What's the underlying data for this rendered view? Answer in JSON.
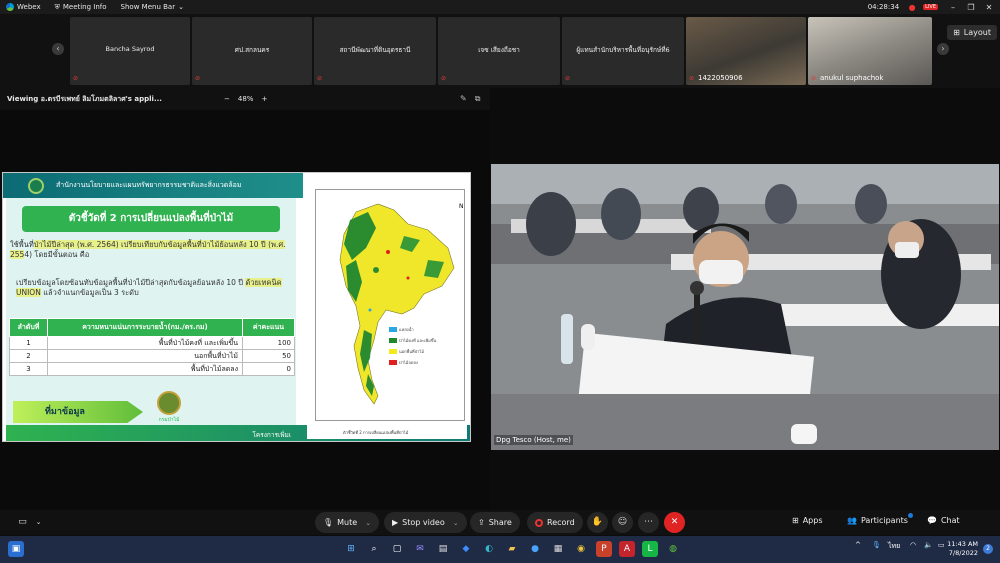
{
  "topbar": {
    "app_name": "Webex",
    "meeting_info": "Meeting Info",
    "show_menu_bar": "Show Menu Bar",
    "timer": "04:28:34",
    "live_badge": "LIVE"
  },
  "participants": [
    {
      "name": "Bancha Sayrod"
    },
    {
      "name": "ศป.สกลนคร"
    },
    {
      "name": "สถานีพัฒนาที่ดินอุดรธานี"
    },
    {
      "name": "เจซ เสียงถือชา"
    },
    {
      "name": "ผู้แทนสำนักบริหารพื้นที่อนุรักษ์ที่6"
    },
    {
      "name": "1422050906"
    },
    {
      "name": "anukul suphachok"
    }
  ],
  "layout_label": "Layout",
  "sharebar": {
    "viewing": "Viewing อ.ตรบีรเพทย์ ลิมโภมตลิลาศ's appli...",
    "zoom_minus": "−",
    "zoom_value": "48%",
    "zoom_plus": "+"
  },
  "slide": {
    "header": "สำนักงานนโยบายและแผนทรัพยากรธรรมชาติและสิ่งแวดล้อม",
    "title": "ตัวชี้วัดที่ 2 การเปลี่ยนแปลงพื้นที่ป่าไม้",
    "para1_a": "ใช้พื้นที่",
    "para1_b": "ป่าไม้ปีล่าสุด (พ.ศ. 2564) เปรียบเทียบกับข้อมูลพื้นที่ป่าไม้ย้อนหลัง 10 ปี (พ.ศ. 255",
    "para1_c": "4) โดยมีขั้นตอน คือ",
    "para2_a": "เปรียบข้อมูลโดยซ้อนทับข้อมูลพื้นที่ป่าไม้ปีล่าสุดกับข้อมูลย้อนหลัง 10 ปี",
    "para2_b": "ด้วยเทคนิค UNION",
    "para2_c": " แล้วจำแนกข้อมูลเป็น 3 ระดับ",
    "table": {
      "headers": [
        "ลำดับที่",
        "ความหนาแน่นการระบายน้ำ(กม./ตร.กม)",
        "ค่าคะแนน"
      ],
      "rows": [
        {
          "no": "1",
          "desc": "พื้นที่ป่าไม้คงที่ และเพิ่มขึ้น",
          "score": "100"
        },
        {
          "no": "2",
          "desc": "นอกพื้นที่ป่าไม้",
          "score": "50"
        },
        {
          "no": "3",
          "desc": "พื้นที่ป่าไม้ลดลง",
          "score": "0"
        }
      ]
    },
    "source_label": "ที่มาข้อมูล",
    "source_logo_text": "กรมป่าไม้",
    "footer": "โครงการเพิ่มเ",
    "map_legend": [
      {
        "label": "แหล่งน้ำ",
        "color": "#2aa7e0"
      },
      {
        "label": "ป่าไม้คงที่ และเพิ่มขึ้น",
        "color": "#1f8a2c"
      },
      {
        "label": "นอกพื้นที่ป่าไม้",
        "color": "#f2ea1c"
      },
      {
        "label": "ป่าไม้ลดลง",
        "color": "#e01f1f"
      }
    ],
    "map_caption": "ตัวชี้วัดที่ 2 การเปลี่ยนแปลงพื้นที่ป่าไม้",
    "north": "N"
  },
  "video_label": "Dpg Tesco (Host, me)",
  "controls": {
    "mute": "Mute",
    "stop_video": "Stop video",
    "share": "Share",
    "record": "Record",
    "apps": "Apps",
    "participants": "Participants",
    "chat": "Chat"
  },
  "taskbar": {
    "lang": "ไทย",
    "time": "11:43 AM",
    "date": "7/8/2022",
    "notif_count": "2"
  }
}
